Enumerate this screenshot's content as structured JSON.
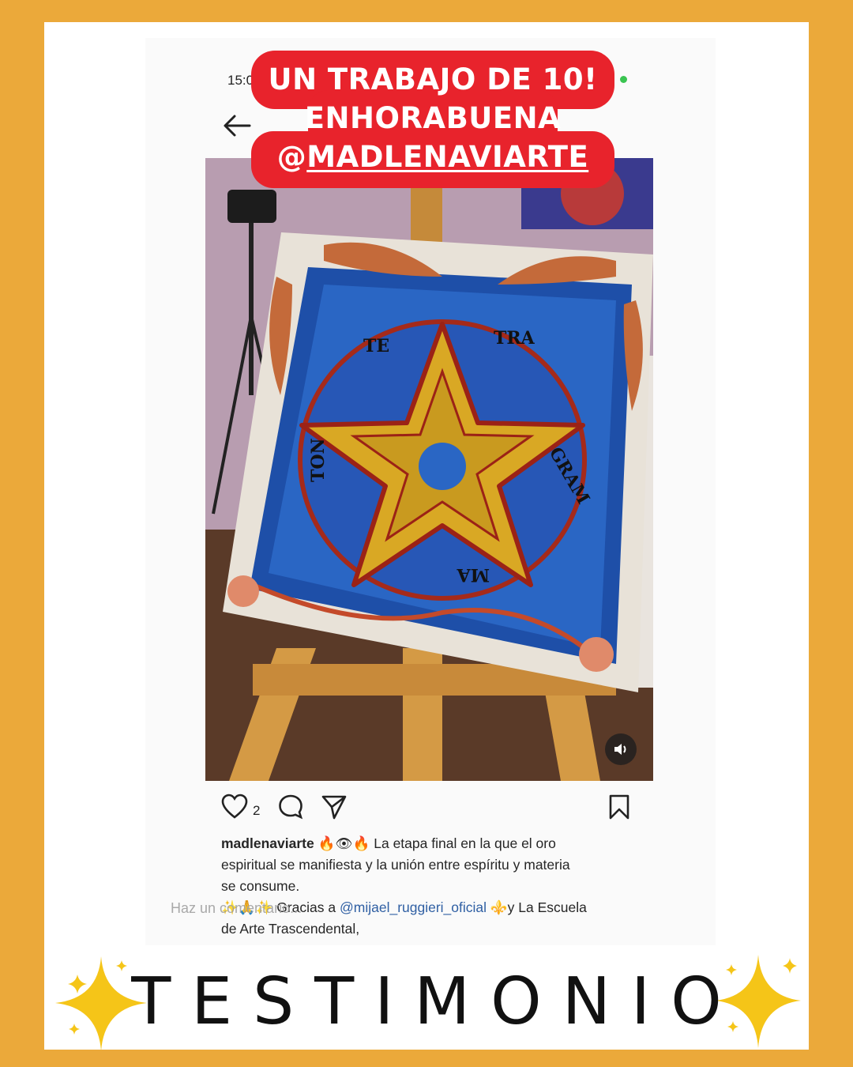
{
  "banner": {
    "line1": "UN TRABAJO DE 10!",
    "line2": "ENHORABUENA",
    "line3_prefix": "@",
    "line3_handle": "MADLENAVIARTE"
  },
  "status": {
    "time": "15:0"
  },
  "post": {
    "likes": "2",
    "caption_user": "madlenaviarte",
    "caption_emoji1": "🔥👁🔥",
    "caption_line1": "La etapa final en la que el oro",
    "caption_line2": "espiritual se manifiesta y la unión entre espíritu y materia",
    "caption_line3": "se consume.",
    "caption_line4_a": "✨🙏✨ Gracias a ",
    "caption_mention": "@mijael_ruggieri_oficial",
    "caption_line4_b": " ⚜️y La Escuela",
    "caption_line5": "de Arte Trascendental,",
    "comment_placeholder": "Haz un comentario..."
  },
  "painting": {
    "top_left": "TE",
    "top_right": "TRA",
    "left": "TON",
    "right": "GRAM",
    "bottom": "MA"
  },
  "footer": {
    "title": "TESTIMONIO"
  },
  "colors": {
    "frame": "#EBA93A",
    "banner": "#E8232C",
    "sparkle": "#F5C518"
  }
}
